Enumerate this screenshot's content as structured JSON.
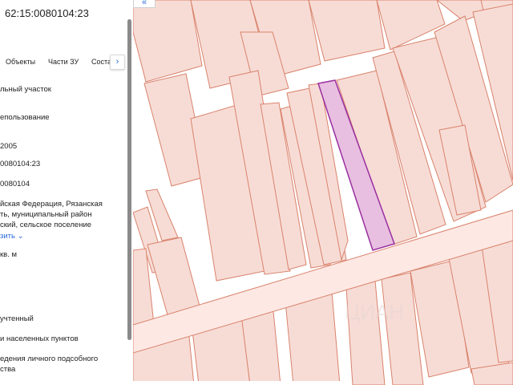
{
  "window": {
    "title": "62:15:0080104:23"
  },
  "tabs": [
    {
      "label": "Объекты"
    },
    {
      "label": "Части ЗУ"
    },
    {
      "label": "Соста"
    }
  ],
  "icons": {
    "next": "chevron-right-icon",
    "back": "chevron-left-icon",
    "expand": "chevron-down-icon"
  },
  "fields": [
    {
      "text": "льный участок"
    },
    {
      "text": "епользование"
    },
    {
      "text": "2005"
    },
    {
      "text": "0080104:23"
    },
    {
      "text": "0080104"
    },
    {
      "text": "йская Федерация, Рязанская"
    },
    {
      "text": "ть, муниципальный район"
    },
    {
      "text": "ский, сельское поселение"
    },
    {
      "text": "кв. м"
    },
    {
      "text": "учтенный"
    },
    {
      "text": "и населенных пунктов"
    },
    {
      "text": "едения личного подсобного"
    },
    {
      "text": "ства"
    }
  ],
  "more_link": {
    "label": "зить"
  },
  "map": {
    "parcel_fill": "#f7dcd6",
    "parcel_border": "#d9836c",
    "road_fill": "#fde8e4",
    "selected_fill": "#e8bfe0",
    "selected_border": "#9a2fa0",
    "background": "#ffffff"
  }
}
